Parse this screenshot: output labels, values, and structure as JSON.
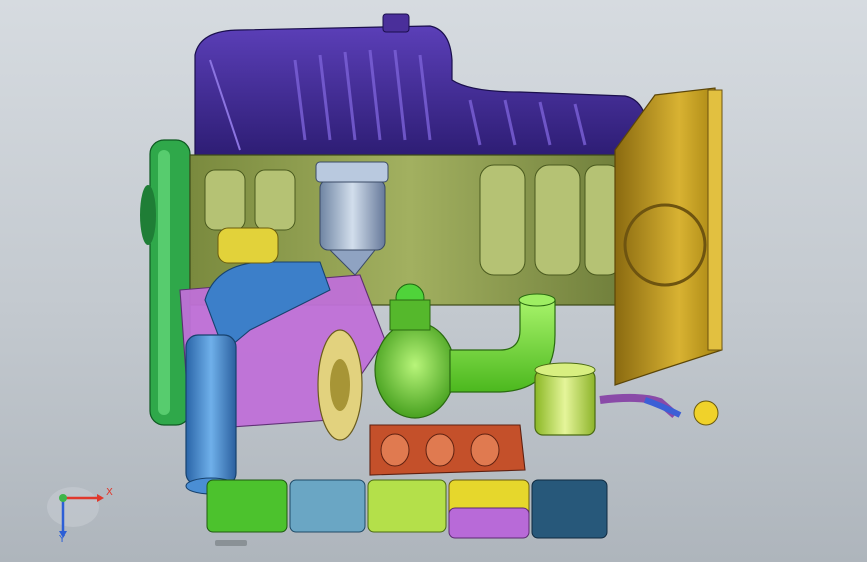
{
  "colors": {
    "background_top": "#d6dbe0",
    "background_bottom": "#aeb5bc",
    "valve_cover": "#4a2f9a",
    "block": "#8a9a4e",
    "bellhousing": "#b8941c",
    "pulley": "#2fa84a",
    "turbo_housing": "#6fd12e",
    "turbo_pipe": "#7ee63a",
    "intercooler_pipe": "#3c7fc9",
    "oil_filter": "#9fb4cf",
    "exhaust_manifold": "#c4502a",
    "oil_pan_green": "#4cc22d",
    "oil_pan_blue": "#6aa6c4",
    "oil_pan_yellow": "#e6d72c",
    "oil_pan_magenta": "#b86ad8",
    "oil_pan_navy": "#27587a",
    "canister": "#b7e04a",
    "axis_x": "#e0382c",
    "axis_y": "#2c5fd6",
    "axis_z": "#2c5fd6",
    "axis_origin": "#3fb54a"
  },
  "triad": {
    "x_label": "X",
    "y_label": "Y"
  }
}
